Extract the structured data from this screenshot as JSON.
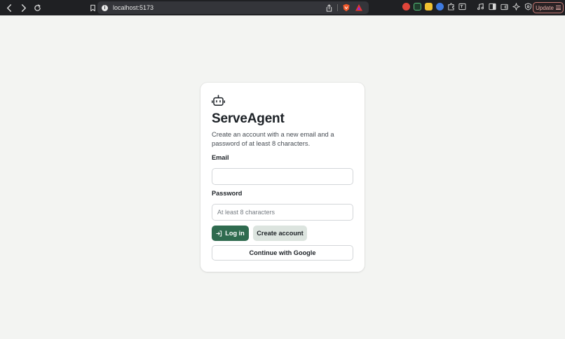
{
  "browser": {
    "url": "localhost:5173",
    "update_label": "Update"
  },
  "app": {
    "title": "ServeAgent",
    "subtitle": "Create an account with a new email and a password of at least 8 characters.",
    "icon": "bot-icon",
    "accent_color": "#2f6b4f"
  },
  "form": {
    "email_label": "Email",
    "email_value": "",
    "email_placeholder": "",
    "password_label": "Password",
    "password_value": "",
    "password_placeholder": "At least 8 characters",
    "login_label": "Log in",
    "create_label": "Create account",
    "google_label": "Continue with Google"
  }
}
